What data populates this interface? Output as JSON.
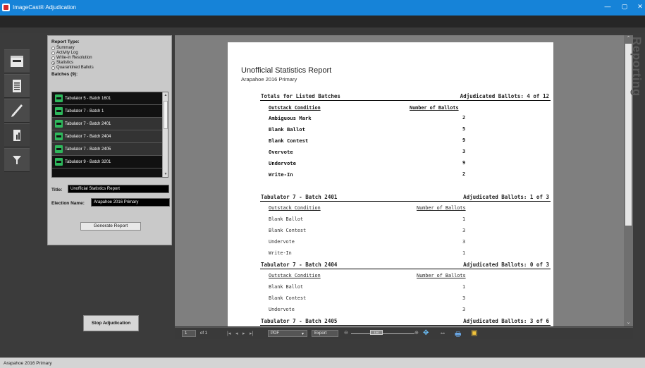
{
  "window": {
    "title": "ImageCast® Adjudication",
    "controls": {
      "minimize": "—",
      "restore": "▢",
      "close": "✕"
    }
  },
  "side_label": "Reporting",
  "rail": {
    "tabs": [
      {
        "icon": "ballot-icon"
      },
      {
        "icon": "ballot-list-icon"
      },
      {
        "icon": "pen-icon"
      },
      {
        "icon": "report-icon"
      },
      {
        "icon": "filter-icon"
      }
    ]
  },
  "panel": {
    "report_type_label": "Report Type:",
    "report_types": [
      {
        "label": "Summary",
        "selected": false
      },
      {
        "label": "Activity Log",
        "selected": false
      },
      {
        "label": "Write-in Resolution",
        "selected": false
      },
      {
        "label": "Statistics",
        "selected": true
      },
      {
        "label": "Quarantined Ballots",
        "selected": false
      }
    ],
    "batches_label": "Batches (9):",
    "batches": [
      {
        "label": "Tabulator 5 - Batch 1601",
        "selected": false
      },
      {
        "label": "Tabulator 7 - Batch 1",
        "selected": false
      },
      {
        "label": "Tabulator 7 - Batch 2401",
        "selected": true
      },
      {
        "label": "Tabulator 7 - Batch 2404",
        "selected": true
      },
      {
        "label": "Tabulator 7 - Batch 2405",
        "selected": true
      },
      {
        "label": "Tabulator 9 - Batch 3201",
        "selected": false
      }
    ],
    "title_label": "Title:",
    "title_value": "Unofficial Statistics Report",
    "election_label": "Election Name:",
    "election_value": "Arapahoe 2016 Primary",
    "generate_label": "Generate Report"
  },
  "stop_label": "Stop Adjudication",
  "report": {
    "title": "Unofficial Statistics Report",
    "subtitle": "Arapahoe 2016 Primary",
    "totals": {
      "heading": "Totals for Listed Batches",
      "adjudicated": "Adjudicated Ballots: 4 of 12",
      "col_condition": "Outstack Condition",
      "col_count": "Number of Ballots",
      "rows": [
        {
          "condition": "Ambiguous Mark",
          "count": "2"
        },
        {
          "condition": "Blank Ballot",
          "count": "5"
        },
        {
          "condition": "Blank Contest",
          "count": "9"
        },
        {
          "condition": "Overvote",
          "count": "3"
        },
        {
          "condition": "Undervote",
          "count": "9"
        },
        {
          "condition": "Write-In",
          "count": "2"
        }
      ]
    },
    "batches": [
      {
        "heading": "Tabulator 7 - Batch 2401",
        "adjudicated": "Adjudicated Ballots: 1 of 3",
        "col_condition": "Outstack Condition",
        "col_count": "Number of Ballots",
        "rows": [
          {
            "condition": "Blank Ballot",
            "count": "1"
          },
          {
            "condition": "Blank Contest",
            "count": "3"
          },
          {
            "condition": "Undervote",
            "count": "3"
          },
          {
            "condition": "Write-In",
            "count": "1"
          }
        ]
      },
      {
        "heading": "Tabulator 7 - Batch 2404",
        "adjudicated": "Adjudicated Ballots: 0 of 3",
        "col_condition": "Outstack Condition",
        "col_count": "Number of Ballots",
        "rows": [
          {
            "condition": "Blank Ballot",
            "count": "1"
          },
          {
            "condition": "Blank Contest",
            "count": "3"
          },
          {
            "condition": "Undervote",
            "count": "3"
          }
        ]
      },
      {
        "heading": "Tabulator 7 - Batch 2405",
        "adjudicated": "Adjudicated Ballots: 3 of 6",
        "rows": []
      }
    ]
  },
  "viewer_toolbar": {
    "page_current": "1",
    "page_of": "of 1",
    "format": "PDF",
    "export_label": "Export",
    "zoom": "100"
  },
  "status": "Arapahoe 2016 Primary",
  "colors": {
    "titlebar": "#1683d8",
    "batch_icon": "#2eb85c",
    "panel": "#c9c9c9"
  }
}
